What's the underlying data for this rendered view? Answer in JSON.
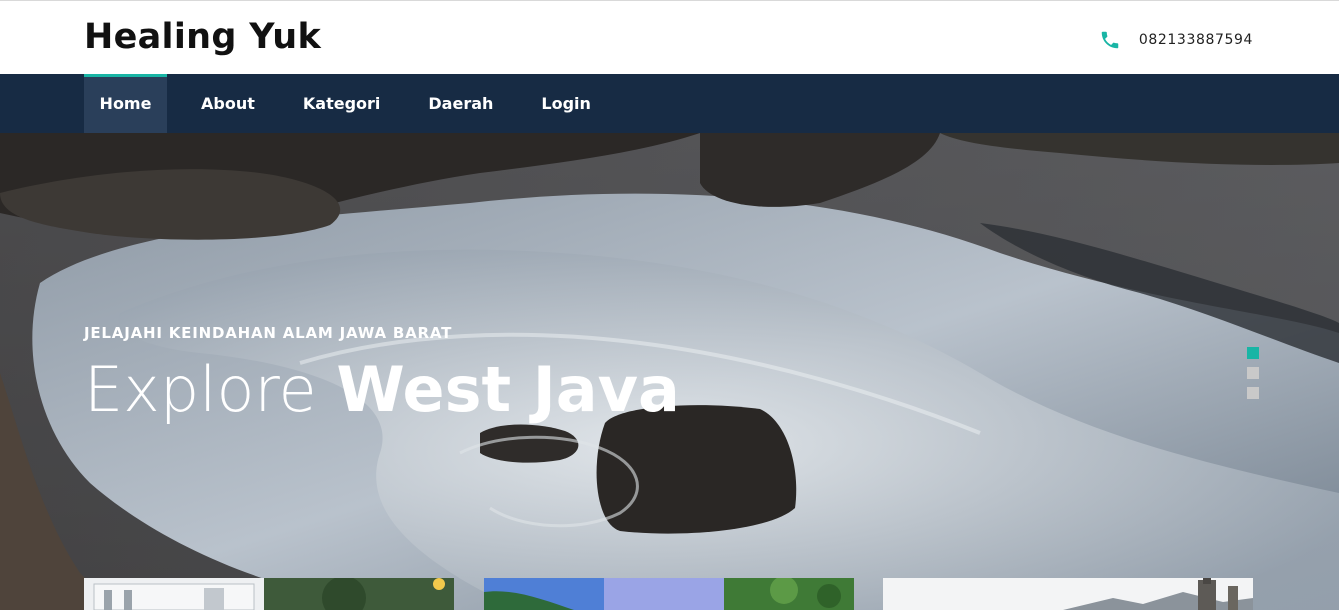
{
  "header": {
    "brand": "Healing Yuk",
    "phone": "082133887594",
    "phone_icon": "phone-icon",
    "accent_color": "#19b5a5"
  },
  "nav": {
    "items": [
      {
        "label": "Home",
        "active": true
      },
      {
        "label": "About",
        "active": false
      },
      {
        "label": "Kategori",
        "active": false
      },
      {
        "label": "Daerah",
        "active": false
      },
      {
        "label": "Login",
        "active": false
      }
    ],
    "background": "#172b44"
  },
  "hero": {
    "subtitle": "JELAJAHI KEINDAHAN ALAM JAWA BARAT",
    "title_light": "Explore",
    "title_bold": "West Java",
    "slides": [
      {
        "active": true
      },
      {
        "active": false
      },
      {
        "active": false
      }
    ]
  },
  "cards": [
    {
      "name": "building-card"
    },
    {
      "name": "lake-card"
    },
    {
      "name": "mountain-card"
    }
  ]
}
